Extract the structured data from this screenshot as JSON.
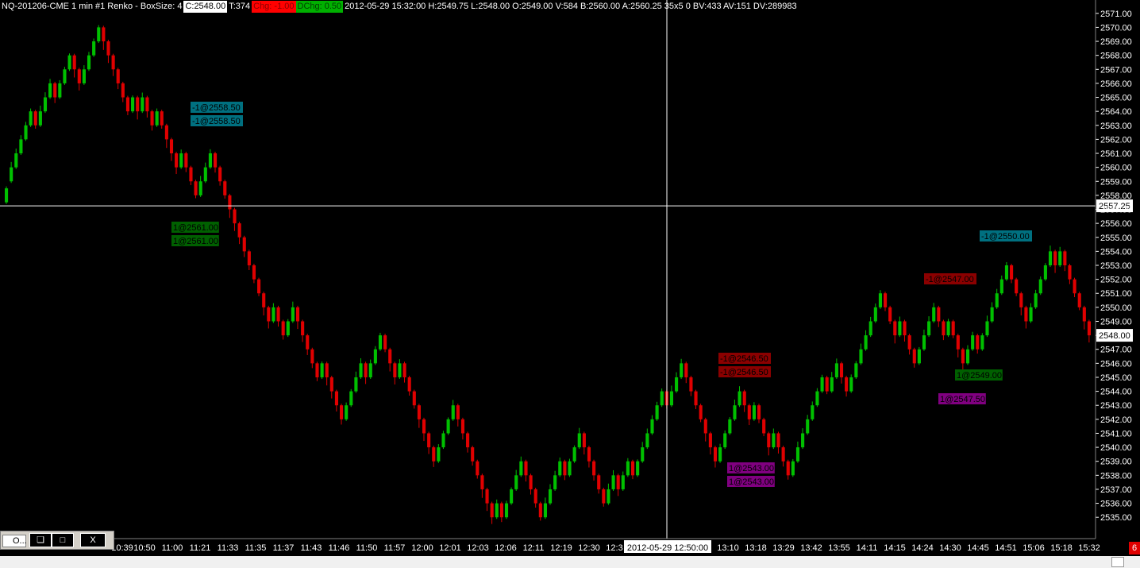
{
  "header": {
    "symbol": "NQ-201206-CME  1 min  #1 Renko - BoxSize: 4",
    "close": "C:2548.00",
    "ticks": "T:374",
    "chg": "Chg: -1.00",
    "dchg": "DChg: 0.50",
    "details": "2012-05-29 15:32:00 H:2549.75 L:2548.00 O:2549.00 V:584 B:2560.00 A:2560.25 35x5 0 BV:433 AV:151 DV:289983"
  },
  "colors": {
    "background": "#000000",
    "up": "#00c000",
    "down": "#e00000",
    "axis_text": "#ffffff",
    "crosshair": "#ffffff",
    "order_teal": "#007080",
    "order_green": "#006000",
    "order_darkred": "#8b0000",
    "order_purple": "#800080"
  },
  "chart_data": {
    "type": "candlestick",
    "title": "",
    "ylim": [
      2534.5,
      2571.5
    ],
    "y_ticks": [
      2535,
      2536,
      2537,
      2538,
      2539,
      2540,
      2541,
      2542,
      2543,
      2544,
      2545,
      2546,
      2547,
      2548,
      2549,
      2550,
      2551,
      2552,
      2553,
      2554,
      2555,
      2556,
      2557,
      2558,
      2559,
      2560,
      2561,
      2562,
      2563,
      2564,
      2565,
      2566,
      2567,
      2568,
      2569,
      2570,
      2571
    ],
    "y_tick_labels": [
      "2535.00",
      "2536.00",
      "2537.00",
      "2538.00",
      "2539.00",
      "2540.00",
      "2541.00",
      "2542.00",
      "2543.00",
      "2544.00",
      "2545.00",
      "2546.00",
      "2547.00",
      "2548.00",
      "2549.00",
      "2550.00",
      "2551.00",
      "2552.00",
      "2553.00",
      "2554.00",
      "2555.00",
      "2556.00",
      "2557.00",
      "2558.00",
      "2559.00",
      "2560.00",
      "2561.00",
      "2562.00",
      "2563.00",
      "2564.00",
      "2565.00",
      "2566.00",
      "2567.00",
      "2568.00",
      "2569.00",
      "2570.00",
      "2571.00"
    ],
    "x_tick_labels": [
      "10:39",
      "10:50",
      "11:00",
      "11:21",
      "11:33",
      "11:35",
      "11:37",
      "11:43",
      "11:46",
      "11:50",
      "11:57",
      "12:00",
      "12:01",
      "12:03",
      "12:06",
      "12:11",
      "12:19",
      "12:30",
      "12:3",
      "12:50:00",
      "13:10",
      "13:18",
      "13:29",
      "13:42",
      "13:55",
      "14:11",
      "14:15",
      "14:24",
      "14:30",
      "14:45",
      "14:51",
      "15:06",
      "15:18",
      "15:32"
    ],
    "crosshair_x_label": "2012-05-29  12:50:00",
    "crosshair_price": "2557.25",
    "last_price": "2548.00",
    "closes": [
      2558.5,
      2560,
      2561,
      2562,
      2563,
      2564,
      2563,
      2564,
      2565,
      2566,
      2565,
      2566,
      2567,
      2568,
      2567,
      2566,
      2567,
      2568,
      2569,
      2570,
      2569,
      2568,
      2567,
      2566,
      2565,
      2564,
      2565,
      2564,
      2565,
      2564,
      2563,
      2564,
      2563,
      2562,
      2561,
      2560,
      2561,
      2560,
      2559,
      2558,
      2559,
      2560,
      2561,
      2560,
      2559,
      2558,
      2557,
      2556,
      2555,
      2554,
      2553,
      2552,
      2551,
      2550,
      2549,
      2550,
      2549,
      2548,
      2549,
      2550,
      2549,
      2548,
      2547,
      2546,
      2545,
      2546,
      2545,
      2544,
      2543,
      2542,
      2543,
      2544,
      2545,
      2546,
      2545,
      2546,
      2547,
      2548,
      2547,
      2546,
      2545,
      2546,
      2545,
      2544,
      2543,
      2542,
      2541,
      2540,
      2539,
      2540,
      2541,
      2542,
      2543,
      2542,
      2541,
      2540,
      2539,
      2538,
      2537,
      2536,
      2535,
      2536,
      2535,
      2536,
      2537,
      2538,
      2539,
      2538,
      2537,
      2536,
      2535,
      2536,
      2537,
      2538,
      2539,
      2538,
      2539,
      2540,
      2541,
      2540,
      2539,
      2538,
      2537,
      2536,
      2537,
      2538,
      2537,
      2538,
      2539,
      2538,
      2539,
      2540,
      2541,
      2542,
      2543,
      2544,
      2543,
      2544,
      2545,
      2546,
      2545,
      2544,
      2543,
      2542,
      2541,
      2540,
      2539,
      2540,
      2541,
      2542,
      2543,
      2544,
      2543,
      2542,
      2543,
      2542,
      2541,
      2540,
      2541,
      2540,
      2539,
      2538,
      2539,
      2540,
      2541,
      2542,
      2543,
      2544,
      2545,
      2544,
      2545,
      2546,
      2545,
      2544,
      2545,
      2546,
      2547,
      2548,
      2549,
      2550,
      2551,
      2550,
      2549,
      2548,
      2549,
      2548,
      2547,
      2546,
      2547,
      2548,
      2549,
      2550,
      2549,
      2548,
      2549,
      2548,
      2547,
      2546,
      2547,
      2548,
      2547,
      2548,
      2549,
      2550,
      2551,
      2552,
      2553,
      2552,
      2551,
      2550,
      2549,
      2550,
      2551,
      2552,
      2553,
      2554,
      2553,
      2554,
      2553,
      2552,
      2551,
      2550,
      2549,
      2548
    ]
  },
  "orders": [
    {
      "text": "-1@2558.50",
      "color": "#007080",
      "x": 240,
      "y": 128
    },
    {
      "text": "-1@2558.50",
      "color": "#007080",
      "x": 240,
      "y": 145
    },
    {
      "text": "1@2561.00",
      "color": "#006000",
      "x": 216,
      "y": 279
    },
    {
      "text": "1@2561.00",
      "color": "#006000",
      "x": 216,
      "y": 296
    },
    {
      "text": "-1@2546.50",
      "color": "#8b0000",
      "x": 905,
      "y": 444
    },
    {
      "text": "-1@2546.50",
      "color": "#8b0000",
      "x": 905,
      "y": 461
    },
    {
      "text": "1@2543.00",
      "color": "#800080",
      "x": 916,
      "y": 582
    },
    {
      "text": "1@2543.00",
      "color": "#800080",
      "x": 916,
      "y": 599
    },
    {
      "text": "-1@2547.00",
      "color": "#8b0000",
      "x": 1164,
      "y": 344
    },
    {
      "text": "1@2549.00",
      "color": "#006000",
      "x": 1203,
      "y": 465
    },
    {
      "text": "1@2547.50",
      "color": "#800080",
      "x": 1182,
      "y": 495
    },
    {
      "text": "-1@2550.00",
      "color": "#007080",
      "x": 1234,
      "y": 290
    }
  ],
  "mini_window": {
    "title": "O..."
  },
  "status_badge": "6"
}
